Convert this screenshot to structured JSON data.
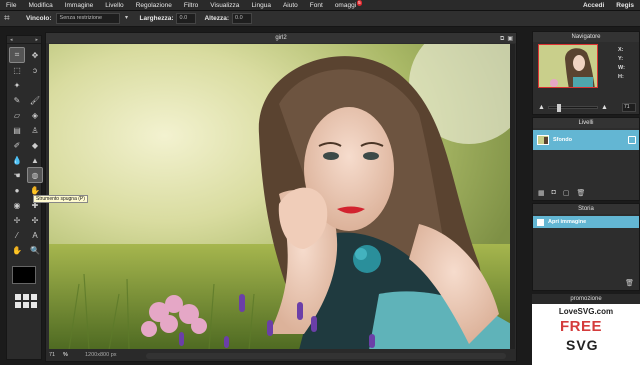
{
  "menubar": {
    "items": [
      "File",
      "Modifica",
      "Immagine",
      "Livello",
      "Regolazione",
      "Filtro",
      "Visualizza",
      "Lingua",
      "Aiuto",
      "Font",
      "omaggi"
    ],
    "badge": "5",
    "right": [
      "Accedi",
      "Regis"
    ]
  },
  "optbar": {
    "vincolo_label": "Vincolo:",
    "vincolo_value": "Senza restrizione",
    "larghezza_label": "Larghezza:",
    "larghezza_value": "0.0",
    "altezza_label": "Altezza:",
    "altezza_value": "0.0"
  },
  "tools": {
    "tooltip": "Strumento spugna (P)"
  },
  "document": {
    "title": "girl2",
    "zoom": "71",
    "zoom_unit": "%",
    "size": "1200x800 px"
  },
  "navigator": {
    "title": "Navigatore",
    "x_label": "X:",
    "y_label": "Y:",
    "w_label": "W:",
    "h_label": "H:",
    "zoom_value": "71"
  },
  "layers": {
    "title": "Livelli",
    "layer_name": "Sfondo"
  },
  "history": {
    "title": "Storia",
    "item": "Apri immagine"
  },
  "promo": {
    "title": "promozione",
    "brand": "LoveSVG.com",
    "free": "FREE",
    "svg": "SVG"
  },
  "colors": {
    "accent": "#63b6d3",
    "badge": "#e0282e",
    "promo_red": "#d43c3c"
  }
}
